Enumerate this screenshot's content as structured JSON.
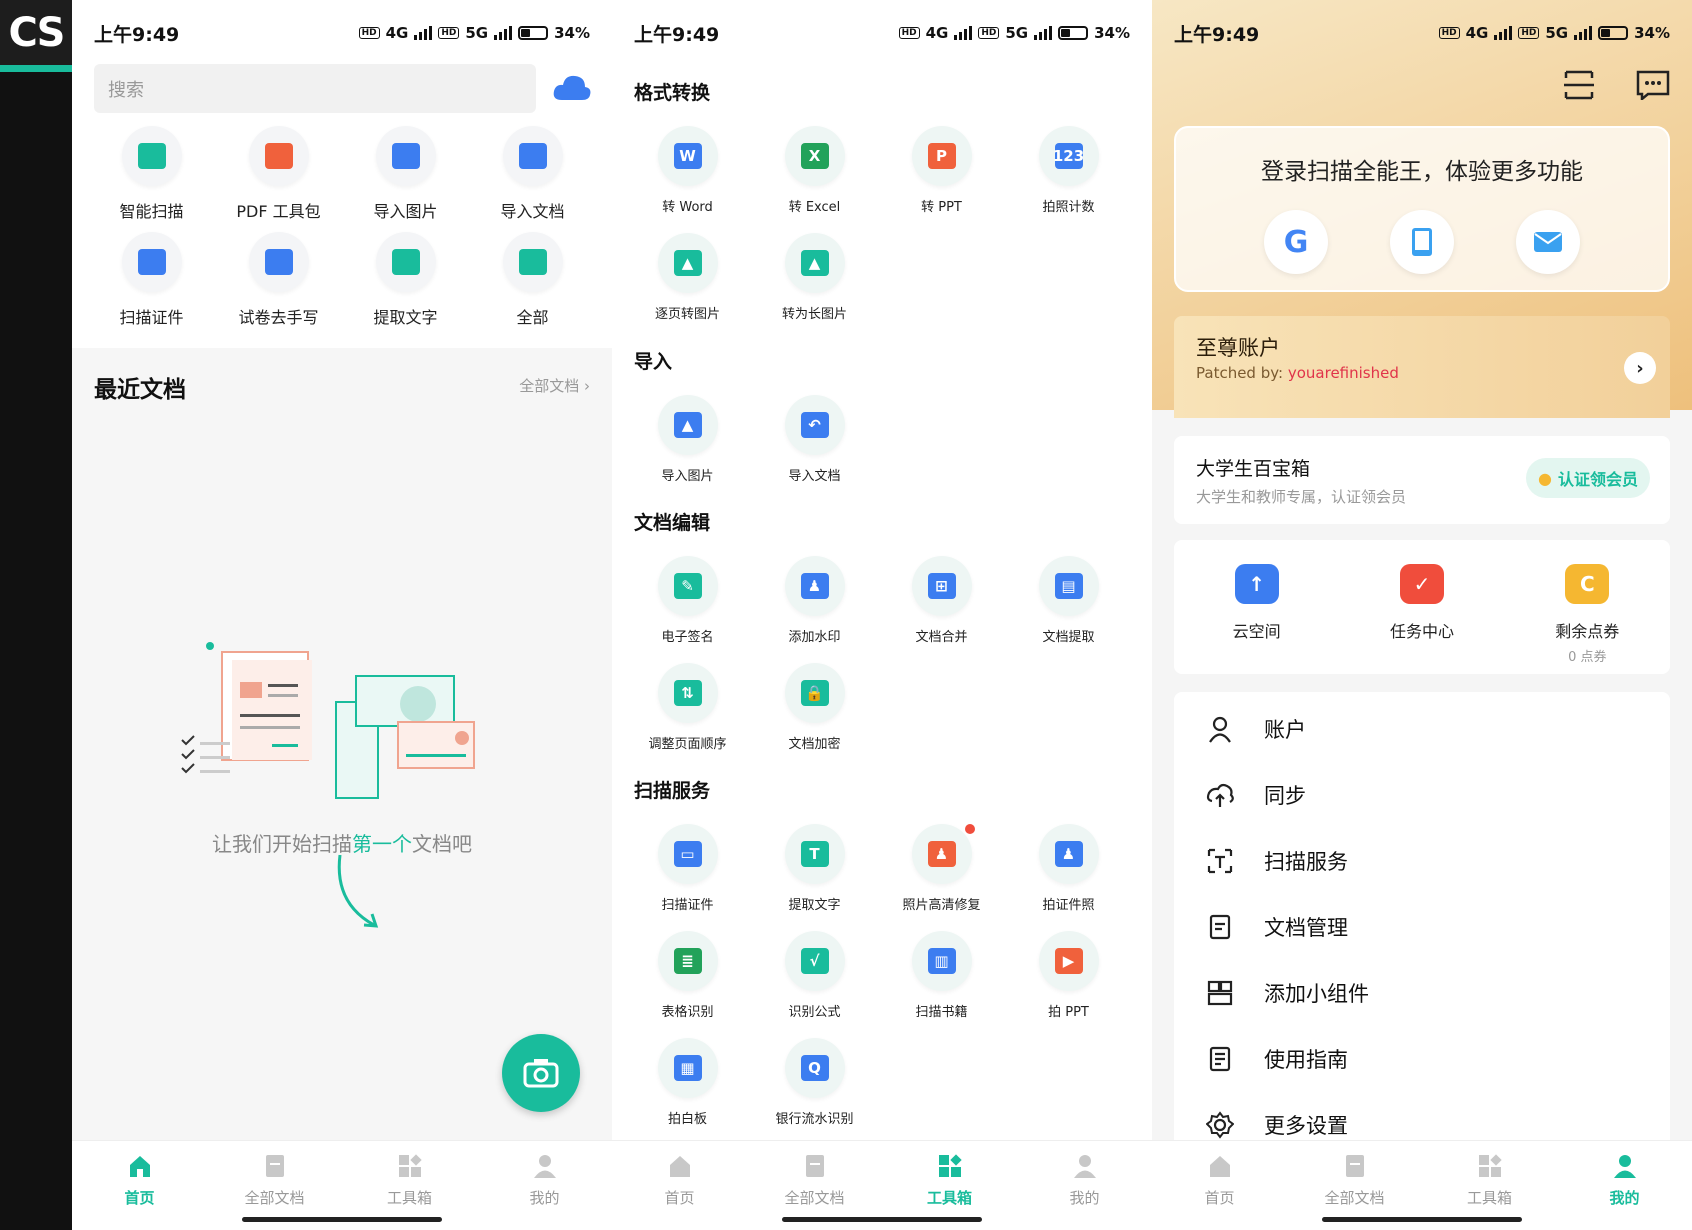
{
  "app_logo": "CS",
  "status": {
    "time": "上午9:49",
    "battery": "34%",
    "net1": "4G",
    "net2": "5G",
    "hd": "HD"
  },
  "home": {
    "search_placeholder": "搜索",
    "tools": [
      {
        "label": "智能扫描",
        "icon": "scan-icon",
        "color": "#19bc9c"
      },
      {
        "label": "PDF 工具包",
        "icon": "pdf-icon",
        "color": "#f0613c"
      },
      {
        "label": "导入图片",
        "icon": "import-image-icon",
        "color": "#3c7df0"
      },
      {
        "label": "导入文档",
        "icon": "import-doc-icon",
        "color": "#3c7df0"
      },
      {
        "label": "扫描证件",
        "icon": "id-card-icon",
        "color": "#3c7df0"
      },
      {
        "label": "试卷去手写",
        "icon": "exam-icon",
        "color": "#3c7df0"
      },
      {
        "label": "提取文字",
        "icon": "text-extract-icon",
        "color": "#19bc9c"
      },
      {
        "label": "全部",
        "icon": "all-apps-icon",
        "color": "#19bc9c"
      }
    ],
    "recent_title": "最近文档",
    "all_docs_link": "全部文档 ›",
    "empty_prefix": "让我们开始扫描",
    "empty_highlight": "第一个",
    "empty_suffix": "文档吧"
  },
  "tabs": [
    "首页",
    "全部文档",
    "工具箱",
    "我的"
  ],
  "toolbox": {
    "sections": [
      {
        "title": "格式转换",
        "items": [
          {
            "label": "转 Word",
            "color": "#3c7df0",
            "glyph": "W"
          },
          {
            "label": "转 Excel",
            "color": "#22a25a",
            "glyph": "X"
          },
          {
            "label": "转 PPT",
            "color": "#f0613c",
            "glyph": "P"
          },
          {
            "label": "拍照计数",
            "color": "#3c7df0",
            "glyph": "123"
          },
          {
            "label": "逐页转图片",
            "color": "#19bc9c",
            "glyph": "▲"
          },
          {
            "label": "转为长图片",
            "color": "#19bc9c",
            "glyph": "▲"
          }
        ]
      },
      {
        "title": "导入",
        "items": [
          {
            "label": "导入图片",
            "color": "#3c7df0",
            "glyph": "▲"
          },
          {
            "label": "导入文档",
            "color": "#3c7df0",
            "glyph": "↶"
          }
        ]
      },
      {
        "title": "文档编辑",
        "items": [
          {
            "label": "电子签名",
            "color": "#19bc9c",
            "glyph": "✎"
          },
          {
            "label": "添加水印",
            "color": "#3c7df0",
            "glyph": "♟"
          },
          {
            "label": "文档合并",
            "color": "#3c7df0",
            "glyph": "⊞"
          },
          {
            "label": "文档提取",
            "color": "#3c7df0",
            "glyph": "▤"
          },
          {
            "label": "调整页面顺序",
            "color": "#19bc9c",
            "glyph": "⇅"
          },
          {
            "label": "文档加密",
            "color": "#19bc9c",
            "glyph": "🔒"
          }
        ]
      },
      {
        "title": "扫描服务",
        "items": [
          {
            "label": "扫描证件",
            "color": "#3c7df0",
            "glyph": "▭"
          },
          {
            "label": "提取文字",
            "color": "#19bc9c",
            "glyph": "T"
          },
          {
            "label": "照片高清修复",
            "color": "#f0613c",
            "glyph": "♟"
          },
          {
            "label": "拍证件照",
            "color": "#3c7df0",
            "glyph": "♟"
          },
          {
            "label": "表格识别",
            "color": "#22a25a",
            "glyph": "≣"
          },
          {
            "label": "识别公式",
            "color": "#19bc9c",
            "glyph": "√"
          },
          {
            "label": "扫描书籍",
            "color": "#3c7df0",
            "glyph": "▥"
          },
          {
            "label": "拍 PPT",
            "color": "#f0613c",
            "glyph": "▶"
          },
          {
            "label": "拍白板",
            "color": "#3c7df0",
            "glyph": "▦"
          },
          {
            "label": "银行流水识别",
            "color": "#3c7df0",
            "glyph": "Q"
          }
        ]
      }
    ]
  },
  "mine": {
    "login_title": "登录扫描全能王，体验更多功能",
    "vip_title": "至尊账户",
    "vip_sub_prefix": "Patched by: ",
    "vip_sub_name": "youarefinished",
    "student_title": "大学生百宝箱",
    "student_sub": "大学生和教师专属，认证领会员",
    "student_badge": "认证领会员",
    "quick": [
      {
        "label": "云空间",
        "sub": "",
        "color": "#3c7df0",
        "icon": "cloud-upload-icon"
      },
      {
        "label": "任务中心",
        "sub": "",
        "color": "#f04d3c",
        "icon": "task-icon"
      },
      {
        "label": "剩余点券",
        "sub": "0 点券",
        "color": "#f5b731",
        "icon": "coupon-icon"
      }
    ],
    "menu": [
      {
        "label": "账户",
        "icon": "user-icon"
      },
      {
        "label": "同步",
        "icon": "sync-icon"
      },
      {
        "label": "扫描服务",
        "icon": "scan-text-icon"
      },
      {
        "label": "文档管理",
        "icon": "document-icon"
      },
      {
        "label": "添加小组件",
        "icon": "widget-icon"
      },
      {
        "label": "使用指南",
        "icon": "guide-icon"
      },
      {
        "label": "更多设置",
        "icon": "settings-icon"
      }
    ]
  }
}
